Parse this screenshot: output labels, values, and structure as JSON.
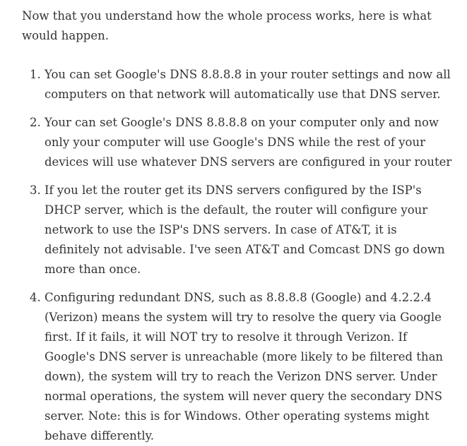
{
  "article": {
    "intro": "Now that you understand how the whole process works, here is what would happen.",
    "items": [
      "You can set Google's DNS 8.8.8.8 in your router settings and now all computers on that network will automatically use that DNS server.",
      "Your can set Google's DNS 8.8.8.8 on your computer only and now only your computer will use Google's DNS while the rest of your devices will use whatever DNS servers are configured in your router",
      "If you let the router get its DNS servers configured by the ISP's DHCP server, which is the default, the router will configure your network to use the ISP's DNS servers. In case of AT&T, it is definitely not advisable. I've seen AT&T and Comcast DNS go down more than once.",
      "Configuring redundant DNS, such as 8.8.8.8 (Google) and 4.2.2.4 (Verizon) means the system will try to resolve the query via Google first. If it fails, it will NOT try to resolve it through Verizon. If Google's DNS server is unreachable (more likely to be filtered than down), the system will try to reach the Verizon DNS server. Under normal operations, the system will never query the secondary DNS server. Note: this is for Windows. Other operating systems might behave differently."
    ]
  }
}
